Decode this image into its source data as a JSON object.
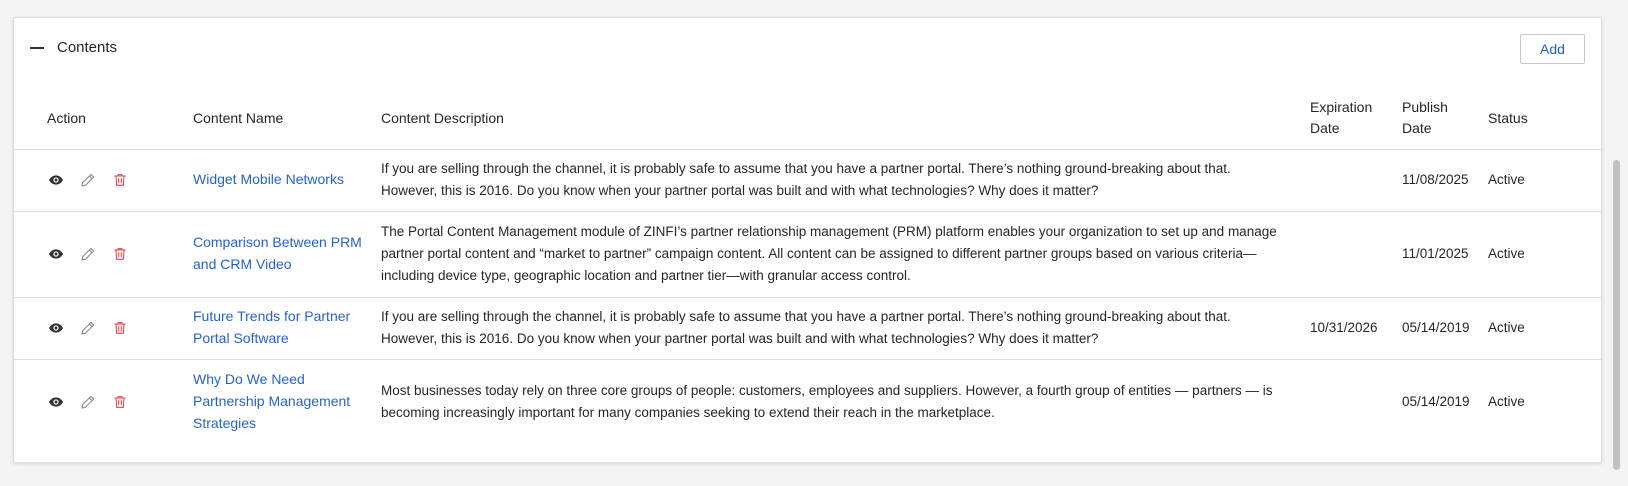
{
  "panel": {
    "title": "Contents",
    "add_label": "Add"
  },
  "table": {
    "headers": {
      "action": "Action",
      "name": "Content Name",
      "description": "Content Description",
      "expiration_line1": "Expiration",
      "expiration_line2": "Date",
      "publish_line1": "Publish",
      "publish_line2": "Date",
      "status": "Status"
    },
    "rows": [
      {
        "name": "Widget Mobile Networks",
        "description": "If you are selling through the channel, it is probably safe to assume that you have a partner portal. There’s nothing ground-breaking about that. However, this is 2016. Do you know when your partner portal was built and with what technologies? Why does it matter?",
        "expiration": "",
        "publish": "11/08/2025",
        "status": "Active"
      },
      {
        "name": "Comparison Between PRM and CRM Video",
        "description": "The Portal Content Management module of ZINFI’s partner relationship management (PRM) platform enables your organization to set up and manage partner portal content and “market to partner” campaign content. All content can be assigned to different partner groups based on various criteria—including device type, geographic location and partner tier—with granular access control.",
        "expiration": "",
        "publish": "11/01/2025",
        "status": "Active"
      },
      {
        "name": "Future Trends for Partner Portal Software",
        "description": "If you are selling through the channel, it is probably safe to assume that you have a partner portal. There’s nothing ground-breaking about that. However, this is 2016. Do you know when your partner portal was built and with what technologies? Why does it matter?",
        "expiration": "10/31/2026",
        "publish": "05/14/2019",
        "status": "Active"
      },
      {
        "name": "Why Do We Need Partnership Management Strategies",
        "description": "Most businesses today rely on three core groups of people: customers, employees and suppliers. However, a fourth group of entities — partners — is becoming increasingly important for many companies seeking to extend their reach in the marketplace.",
        "expiration": "",
        "publish": "05/14/2019",
        "status": "Active"
      }
    ]
  },
  "icons": {
    "view": "eye-icon",
    "edit": "pencil-icon",
    "delete": "trash-icon",
    "collapse": "minus-icon"
  },
  "colors": {
    "link": "#2563c9",
    "delete": "#e0474c",
    "edit": "#8a8a8a",
    "view": "#333333"
  }
}
